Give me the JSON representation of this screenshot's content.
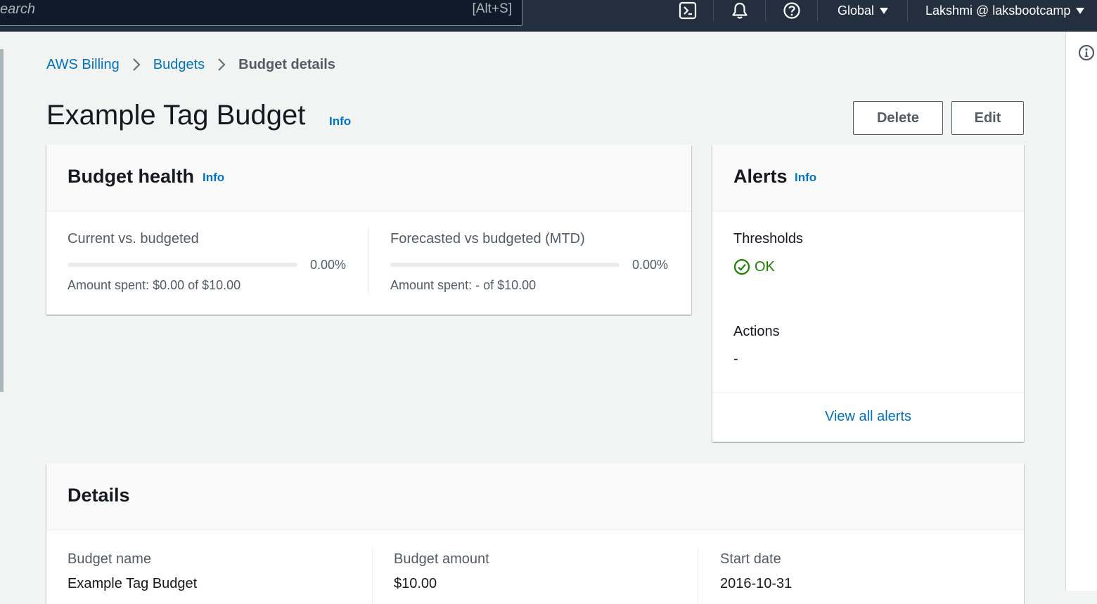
{
  "topbar": {
    "search_placeholder": "earch",
    "search_shortcut": "[Alt+S]",
    "region_label": "Global",
    "account_label": "Lakshmi @ laksbootcamp",
    "icons": [
      "cloudshell-icon",
      "bell-icon",
      "help-icon"
    ]
  },
  "breadcrumb": {
    "items": [
      "AWS Billing",
      "Budgets"
    ],
    "current": "Budget details"
  },
  "page": {
    "title": "Example Tag Budget",
    "info": "Info",
    "delete_label": "Delete",
    "edit_label": "Edit"
  },
  "budget_health": {
    "title": "Budget health",
    "info": "Info",
    "current": {
      "label": "Current vs. budgeted",
      "percent_text": "0.00%",
      "percent_value": 0,
      "amount_text": "Amount spent: $0.00 of $10.00"
    },
    "forecast": {
      "label": "Forecasted vs budgeted (MTD)",
      "percent_text": "0.00%",
      "percent_value": 0,
      "amount_text": "Amount spent: - of $10.00"
    }
  },
  "alerts": {
    "title": "Alerts",
    "info": "Info",
    "thresholds_label": "Thresholds",
    "thresholds_status": "OK",
    "actions_label": "Actions",
    "actions_value": "-",
    "view_all": "View all alerts"
  },
  "details": {
    "title": "Details",
    "budget_name_label": "Budget name",
    "budget_name_value": "Example Tag Budget",
    "budget_amount_label": "Budget amount",
    "budget_amount_value": "$10.00",
    "start_date_label": "Start date",
    "start_date_value": "2016-10-31"
  },
  "colors": {
    "topbar": "#232f3e",
    "link": "#0073bb",
    "ok": "#1d8102",
    "background": "#f2f3f3"
  }
}
